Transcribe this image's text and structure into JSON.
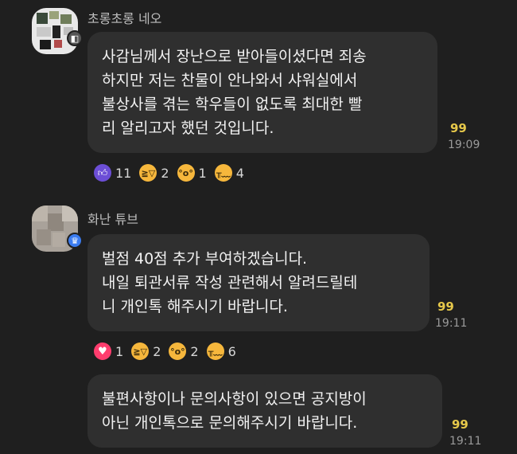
{
  "messages": [
    {
      "sender": "초롱초롱 네오",
      "text": "사감님께서 장난으로 받아들이셨다면 죄송\n하지만 저는 찬물이 안나와서 샤워실에서\n불상사를 겪는 학우들이 없도록 최대한 빨\n리 알리고자 했던 것입니다.",
      "read_count": "99",
      "time": "19:09",
      "reactions": [
        {
          "icon": "thumbs-up-icon",
          "count": "11"
        },
        {
          "icon": "laughing-face-icon",
          "count": "2"
        },
        {
          "icon": "surprised-face-icon",
          "count": "1"
        },
        {
          "icon": "sad-face-icon",
          "count": "4"
        }
      ]
    },
    {
      "sender": "화난 튜브",
      "text": "벌점 40점 추가 부여하겠습니다.\n내일 퇴관서류 작성 관련해서 알려드릴테\n니 개인톡 해주시기 바랍니다.",
      "read_count": "99",
      "time": "19:11",
      "reactions": [
        {
          "icon": "heart-icon",
          "count": "1"
        },
        {
          "icon": "laughing-face-icon",
          "count": "2"
        },
        {
          "icon": "surprised-face-icon",
          "count": "2"
        },
        {
          "icon": "sad-face-icon",
          "count": "6"
        }
      ]
    },
    {
      "text": "불편사항이나 문의사항이 있으면 공지방이\n아닌 개인톡으로 문의해주시기 바랍니다.",
      "read_count": "99",
      "time": "19:11"
    }
  ],
  "colors": {
    "background": "#1f1f1f",
    "bubble": "#2f2f2f",
    "read_count": "#e6c84a",
    "badge_host": "#3b7cf0"
  }
}
